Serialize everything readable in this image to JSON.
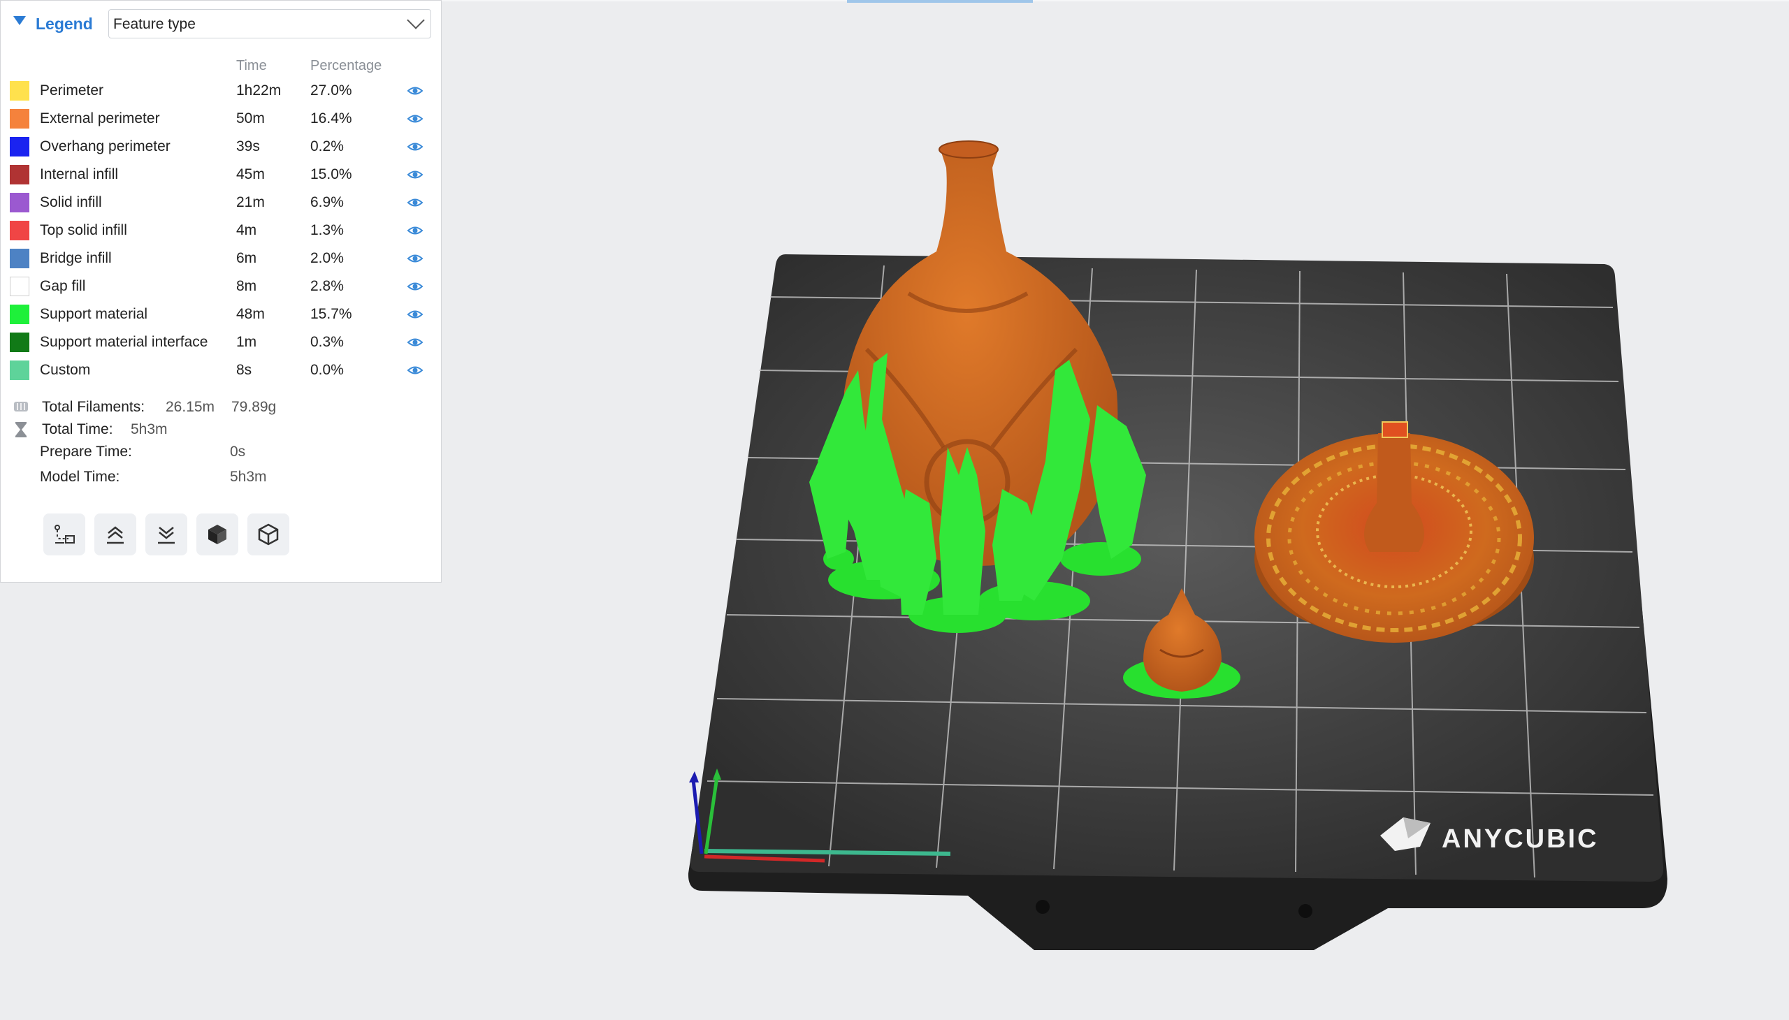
{
  "legend": {
    "title": "Legend",
    "feature_select_value": "Feature type",
    "columns": {
      "time": "Time",
      "percentage": "Percentage"
    },
    "rows": [
      {
        "label": "Perimeter",
        "time": "1h22m",
        "percentage": "27.0%",
        "color": "#ffe14d"
      },
      {
        "label": "External perimeter",
        "time": "50m",
        "percentage": "16.4%",
        "color": "#f5823c"
      },
      {
        "label": "Overhang perimeter",
        "time": "39s",
        "percentage": "0.2%",
        "color": "#1a23f0"
      },
      {
        "label": "Internal infill",
        "time": "45m",
        "percentage": "15.0%",
        "color": "#b03333"
      },
      {
        "label": "Solid infill",
        "time": "21m",
        "percentage": "6.9%",
        "color": "#9b59d0"
      },
      {
        "label": "Top solid infill",
        "time": "4m",
        "percentage": "1.3%",
        "color": "#f04545"
      },
      {
        "label": "Bridge infill",
        "time": "6m",
        "percentage": "2.0%",
        "color": "#4d82c4"
      },
      {
        "label": "Gap fill",
        "time": "8m",
        "percentage": "2.8%",
        "color": "#ffffff"
      },
      {
        "label": "Support material",
        "time": "48m",
        "percentage": "15.7%",
        "color": "#1ef03a"
      },
      {
        "label": "Support material interface",
        "time": "1m",
        "percentage": "0.3%",
        "color": "#117a17"
      },
      {
        "label": "Custom",
        "time": "8s",
        "percentage": "0.0%",
        "color": "#5ed39a"
      }
    ],
    "stats": {
      "total_filaments_label": "Total Filaments:",
      "total_filaments_length": "26.15m",
      "total_filaments_weight": "79.89g",
      "total_time_label": "Total Time:",
      "total_time_value": "5h3m",
      "prepare_time_label": "Prepare Time:",
      "prepare_time_value": "0s",
      "model_time_label": "Model Time:",
      "model_time_value": "5h3m"
    },
    "toolbar_icons": [
      "travel-path-icon",
      "layer-up-icon",
      "layer-down-icon",
      "solid-cube-icon",
      "wireframe-cube-icon"
    ]
  },
  "bed": {
    "brand": "ANYCUBIC",
    "plate_color": "#3a3a3a",
    "grid_color": "#c8c8c8"
  },
  "accent_color": "#2b7bd4"
}
